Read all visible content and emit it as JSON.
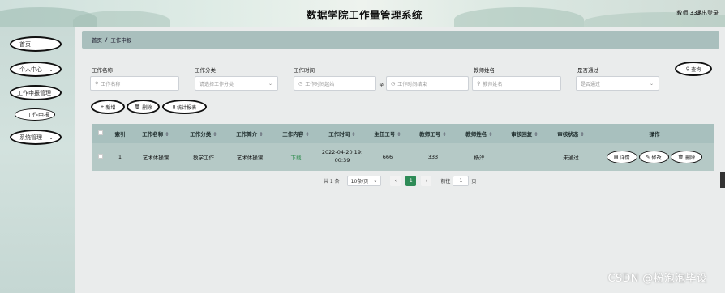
{
  "header": {
    "title": "数据学院工作量管理系统",
    "user": "教师 333",
    "logout": "退出登录"
  },
  "sidebar": {
    "items": [
      {
        "label": "首页"
      },
      {
        "label": "个人中心"
      },
      {
        "label": "工作申报管理"
      },
      {
        "label": "工作申报"
      },
      {
        "label": "系统管理"
      }
    ]
  },
  "breadcrumb": {
    "home": "首页",
    "sep": "/",
    "current": "工作申报"
  },
  "filters": {
    "name_label": "工作名称",
    "name_placeholder": "工作名称",
    "category_label": "工作分类",
    "category_placeholder": "请选择工作分类",
    "time_label": "工作时间",
    "time_start_placeholder": "工作时间起始",
    "time_to": "至",
    "time_end_placeholder": "工作时间结束",
    "teacher_label": "教师姓名",
    "teacher_placeholder": "教师姓名",
    "passed_label": "是否通过",
    "passed_placeholder": "是否通过",
    "search_btn": "查询"
  },
  "actions": {
    "add": "新增",
    "delete": "删除",
    "stats": "统计报表"
  },
  "table": {
    "headers": [
      "索引",
      "工作名称",
      "工作分类",
      "工作简介",
      "工作内容",
      "工作时间",
      "主任工号",
      "教师工号",
      "教师姓名",
      "审核回复",
      "审核状态",
      "操作"
    ],
    "rows": [
      {
        "index": "1",
        "name": "艺术体操课",
        "category": "教学工作",
        "intro": "艺术体操课",
        "content": "下载",
        "time_line1": "2022-04-20 19:",
        "time_line2": "00:39",
        "director_no": "666",
        "teacher_no": "333",
        "teacher_name": "杨洋",
        "reply": "",
        "status": "未通过"
      }
    ],
    "op_detail": "详情",
    "op_edit": "修改",
    "op_delete": "删除"
  },
  "pagination": {
    "total": "共 1 条",
    "page_size": "10条/页",
    "prev": "‹",
    "current": "1",
    "next": "›",
    "goto_label": "前往",
    "goto_value": "1",
    "page_unit": "页"
  },
  "watermark": "CSDN @粉泡泡毕设",
  "colors": {
    "header_accent": "#cfe0dc",
    "table_header": "#a8c0be",
    "table_row": "#b5c9c6",
    "active_page": "#2e8b57"
  }
}
